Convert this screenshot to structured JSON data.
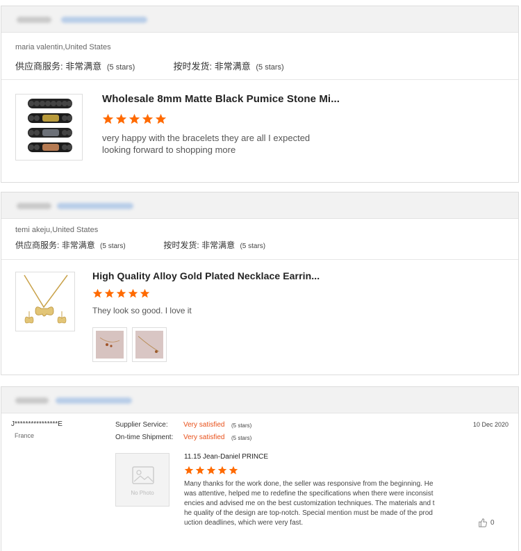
{
  "reviews": [
    {
      "reviewer": "maria valentin,United States",
      "supplier_label": "供应商服务:",
      "supplier_value": "非常满意",
      "supplier_stars": "(5 stars)",
      "shipping_label": "按时发货:",
      "shipping_value": "非常满意",
      "shipping_stars": "(5 stars)",
      "product_title": "Wholesale 8mm Matte Black Pumice Stone Mi...",
      "rating": 5,
      "text_lines": [
        "very happy with the bracelets they are all I expected",
        "looking forward to shopping more"
      ]
    },
    {
      "reviewer": "temi akeju,United States",
      "supplier_label": "供应商服务:",
      "supplier_value": "非常满意",
      "supplier_stars": "(5 stars)",
      "shipping_label": "按时发货:",
      "shipping_value": "非常满意",
      "shipping_stars": "(5 stars)",
      "product_title": "High Quality Alloy Gold Plated Necklace Earrin...",
      "rating": 5,
      "text_lines": [
        "They look so good. I love it"
      ]
    },
    {
      "reviewer": "J****************E",
      "country": "France",
      "supplier_label": "Supplier Service:",
      "supplier_value": "Very satisfied",
      "supplier_stars": "(5 stars)",
      "shipping_label": "On-time Shipment:",
      "shipping_value": "Very satisfied",
      "shipping_stars": "(5 stars)",
      "date": "10 Dec 2020",
      "no_photo_label": "No Photo",
      "product_title": "11.15 Jean-Daniel PRINCE",
      "rating": 5,
      "text_lines": [
        "Many thanks for the work done, the seller was responsive from the beginning. He",
        "was attentive, helped me to redefine the specifications when there were inconsist",
        "encies and advised me on the best customization techniques. The materials and t",
        "he quality of the design are top-notch. Special mention must be made of the prod",
        "uction deadlines, which were very fast."
      ],
      "likes": "0"
    }
  ],
  "colors": {
    "star": "#ff6a00",
    "accent_text": "#e8501a",
    "header_bg": "#f2f2f2"
  },
  "icons": [
    "star-icon",
    "photo-placeholder-icon",
    "thumbs-up-icon"
  ]
}
